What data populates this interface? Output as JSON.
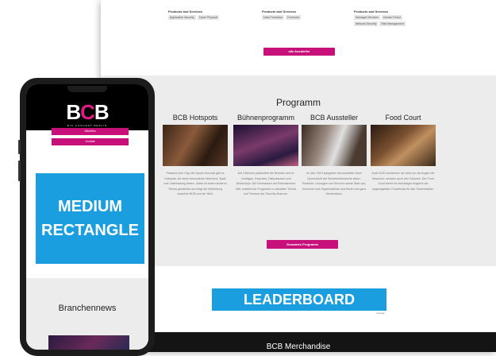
{
  "desktop": {
    "tag_groups": [
      {
        "heading": "Products and Services",
        "tags": [
          "Application Security",
          "Cyber Physical"
        ]
      },
      {
        "heading": "Products and Services",
        "tags": [
          "Data Protection",
          "Forensics"
        ]
      },
      {
        "heading": "Products and Services",
        "tags": [
          "Managed Services",
          "Human Factor",
          "Network Security",
          "Risk Management"
        ]
      }
    ],
    "all_exhibitors_button": "alle Aussteller",
    "programm": {
      "title": "Programm",
      "columns": [
        {
          "heading": "BCB Hotspots",
          "text": "Passend zum City-Life Sports Konzept gibt es Hotspots, die einen besonderen Mehrwert, Spaß und Unterhaltung bieten. Jedes ist einem anderen Thema gewidmet und zeigt die Verbindung zwischen BCB und der Welt."
        },
        {
          "heading": "Bühnenprogramm",
          "text": "Auf 3 Bühnen präsentiert die Branche sich in Vorträgen, Keynotes, Diskussionen und Workshops. Wo Fachwissen auf Entertainment trifft, entsteht ein Programm zu aktuellen Trends und Themen der Security-Branche."
        },
        {
          "heading": "BCB Aussteller",
          "text": "Im Jahr 2019 spiegelten die Aussteller einen Querschnitt der Sicherheitsbranche wider: Produkte, Lösungen und Services sowie Start-ups, Konzerne und Organisationen aus Berlin und ganz Deutschland."
        },
        {
          "heading": "Food Court",
          "text": "Auch 2020 verwöhnen wir nicht nur die Augen der Besucher, sondern auch den Gaumen. Der Food Court bietet ein vielseitiges Angebot der angesagtesten Foodtrucks für alle Geschmäcker."
        }
      ],
      "button": "Gesamtes Programm"
    },
    "leaderboard": "LEADERBOARD",
    "ad_label": "Anzeige",
    "merch_title": "BCB Merchandise"
  },
  "phone": {
    "logo_b1": "B",
    "logo_c": "C",
    "logo_b2": "B",
    "logo_sub": "BIG CONCERT BERLIN",
    "btn1": "Aktuelles",
    "btn2": "Kontakt",
    "medium_rectangle_line1": "MEDIUM",
    "medium_rectangle_line2": "RECTANGLE",
    "branchennews": "Branchennews"
  },
  "colors": {
    "accent": "#c8107a",
    "ad_blue": "#1a9ee0",
    "dark": "#141414"
  }
}
